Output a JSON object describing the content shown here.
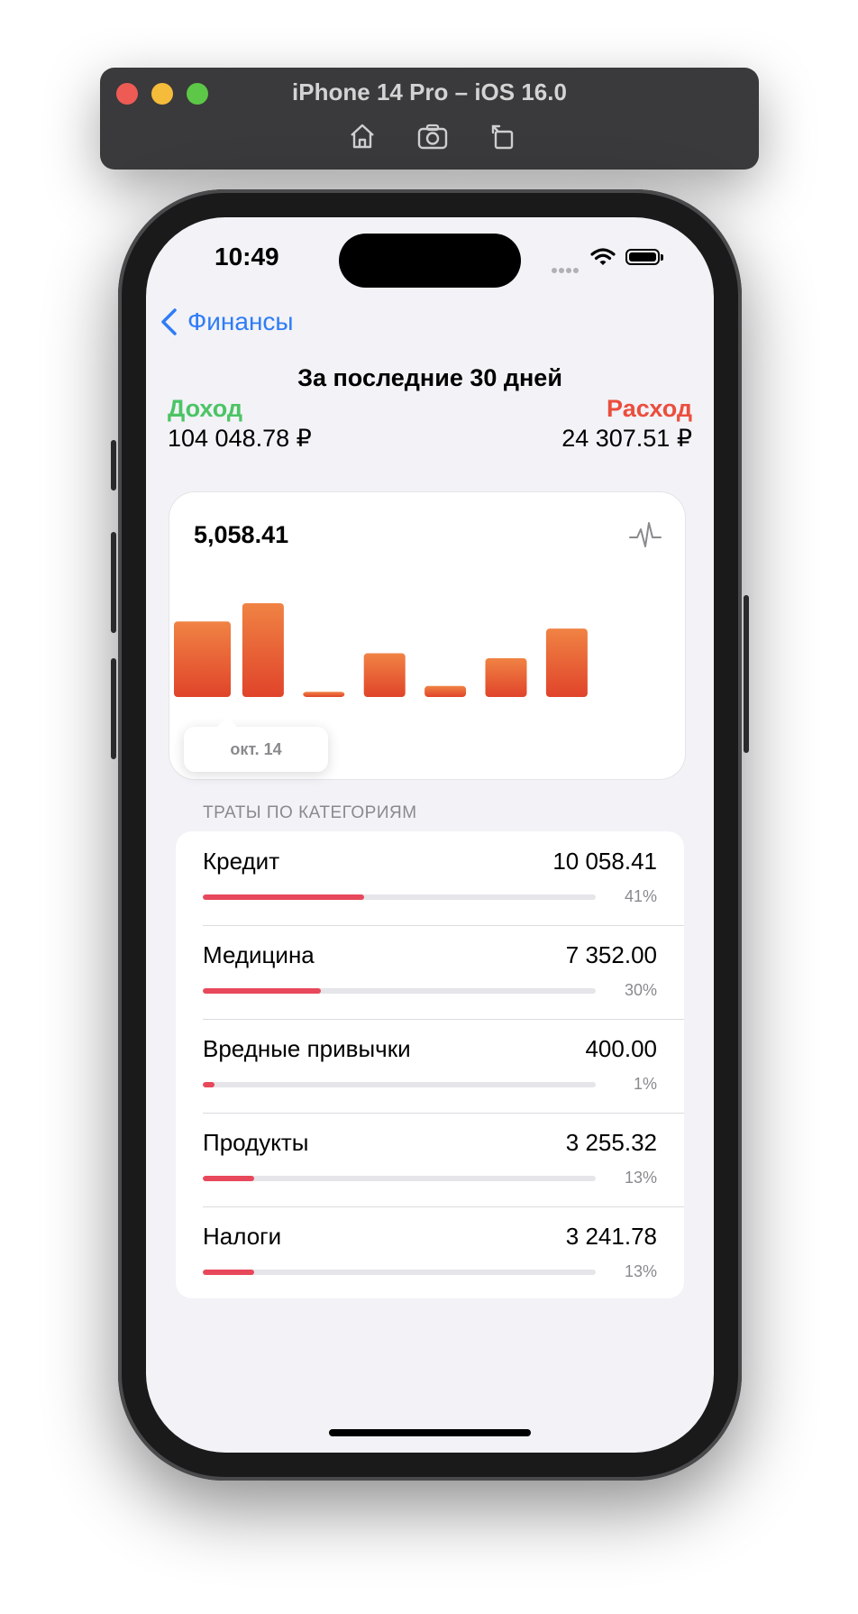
{
  "simulator": {
    "title": "iPhone 14 Pro – iOS 16.0",
    "toolbar": [
      "home-icon",
      "screenshot-icon",
      "rotate-icon"
    ]
  },
  "status_bar": {
    "time": "10:49"
  },
  "nav": {
    "back_label": "Финансы"
  },
  "summary": {
    "period_title": "За последние 30 дней",
    "income_label": "Доход",
    "income_value": "104 048.78 ₽",
    "expense_label": "Расход",
    "expense_value": "24 307.51 ₽"
  },
  "chart_card": {
    "selected_value": "5,058.41",
    "selected_date": "окт. 14",
    "icon": "waveform-icon"
  },
  "chart_data": {
    "type": "bar",
    "values": [
      5058.41,
      6280,
      350,
      2930,
      740,
      2600,
      4580
    ],
    "selected_index": 0,
    "gradient": [
      "#f08344",
      "#e0442a"
    ]
  },
  "categories": {
    "header": "ТРАТЫ ПО КАТЕГОРИЯМ",
    "items": [
      {
        "name": "Кредит",
        "amount": "10 058.41",
        "percent": "41%",
        "fraction": 0.41
      },
      {
        "name": "Медицина",
        "amount": "7 352.00",
        "percent": "30%",
        "fraction": 0.3
      },
      {
        "name": "Вредные привычки",
        "amount": "400.00",
        "percent": "1%",
        "fraction": 0.03
      },
      {
        "name": "Продукты",
        "amount": "3 255.32",
        "percent": "13%",
        "fraction": 0.13
      },
      {
        "name": "Налоги",
        "amount": "3 241.78",
        "percent": "13%",
        "fraction": 0.13
      }
    ]
  },
  "colors": {
    "accent": "#2f7cf6",
    "income": "#4cc464",
    "expense": "#eb4e3d",
    "progress": "#e8485b"
  }
}
